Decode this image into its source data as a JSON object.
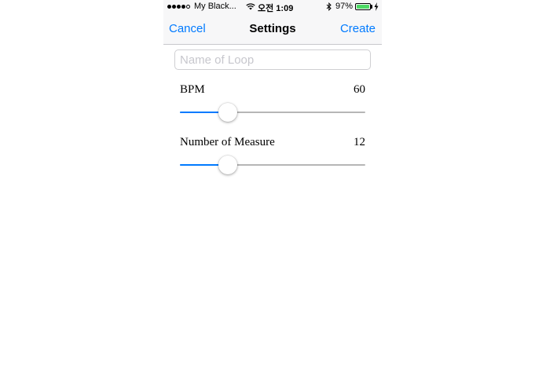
{
  "status_bar": {
    "signal_dots": [
      true,
      true,
      true,
      true,
      false
    ],
    "carrier": "My Black...",
    "wifi_icon": "wifi-icon",
    "time": "오전 1:09",
    "bluetooth_icon": "bluetooth-icon",
    "battery_percent": "97%",
    "battery_level": 0.97,
    "charging_icon": "bolt-icon",
    "battery_color": "#4cd964"
  },
  "nav": {
    "cancel_label": "Cancel",
    "title": "Settings",
    "create_label": "Create",
    "accent_color": "#007aff"
  },
  "form": {
    "name_input": {
      "value": "",
      "placeholder": "Name of Loop"
    },
    "bpm": {
      "label": "BPM",
      "value": "60",
      "slider_fraction": 0.26
    },
    "measures": {
      "label": "Number of Measure",
      "value": "12",
      "slider_fraction": 0.26
    }
  }
}
